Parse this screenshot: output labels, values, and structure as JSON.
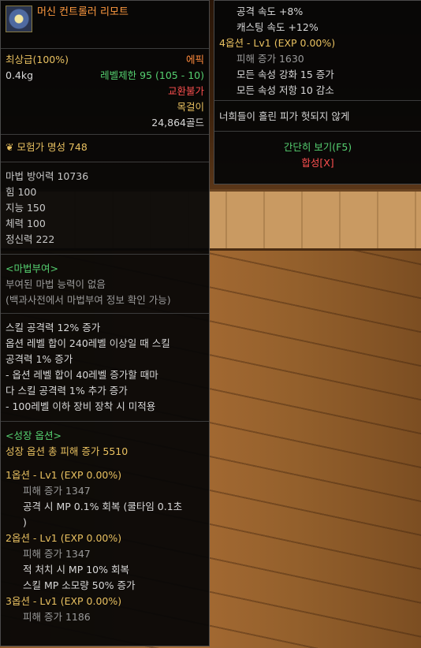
{
  "item": {
    "name": "머신 컨트롤러 리모트",
    "grade": "최상급(100%)",
    "rarity": "에픽",
    "weight": "0.4kg",
    "level_limit": "레벨제한 95 (105 - 10)",
    "trade": "교환불가",
    "type": "목걸이",
    "price": "24,864골드",
    "fame": "모험가 명성 748",
    "stats": [
      "마법 방어력 10736",
      "힘 100",
      "지능 150",
      "체력 100",
      "정신력 222"
    ],
    "enchant": {
      "header": "<마법부여>",
      "none": "부여된 마법 능력이 없음",
      "note": "(백과사전에서 마법부여 정보 확인 가능)"
    },
    "effects": [
      "스킬 공격력 12% 증가",
      "옵션 레벨 합이 240레벨 이상일 때 스킬",
      "공격력 1% 증가",
      "- 옵션 레벨 합이 40레벨 증가할 때마",
      "다 스킬 공격력 1% 추가 증가",
      "- 100레벨 이하 장비 장착 시 미적용"
    ],
    "growth": {
      "header": "<성장 옵션>",
      "total": "성장 옵션 총 피해 증가 5510",
      "opt1": {
        "title": "1옵션 - Lv1 (EXP 0.00%)",
        "dmg": "피해 증가 1347",
        "l1": "공격 시 MP 0.1% 회복 (쿨타임 0.1초",
        "l2": ")"
      },
      "opt2": {
        "title": "2옵션 - Lv1 (EXP 0.00%)",
        "dmg": "피해 증가 1347",
        "l1": "적 처치 시 MP 10% 회복",
        "l2": "스킬 MP 소모량 50% 증가"
      },
      "opt3": {
        "title": "3옵션 - Lv1 (EXP 0.00%)",
        "dmg": "피해 증가 1186"
      }
    }
  },
  "side": {
    "atk_speed": "공격 속도 +8%",
    "cast_speed": "캐스팅 속도 +12%",
    "opt4": {
      "title": "4옵션 - Lv1 (EXP 0.00%)",
      "dmg": "피해 증가 1630",
      "l1": "모든 속성 강화 15 증가",
      "l2": "모든 속성 저항 10 감소"
    },
    "flavor": "너희들이 흘린 피가 헛되지 않게",
    "simple_view": "간단히 보기(F5)",
    "compose": "합성[X]"
  }
}
